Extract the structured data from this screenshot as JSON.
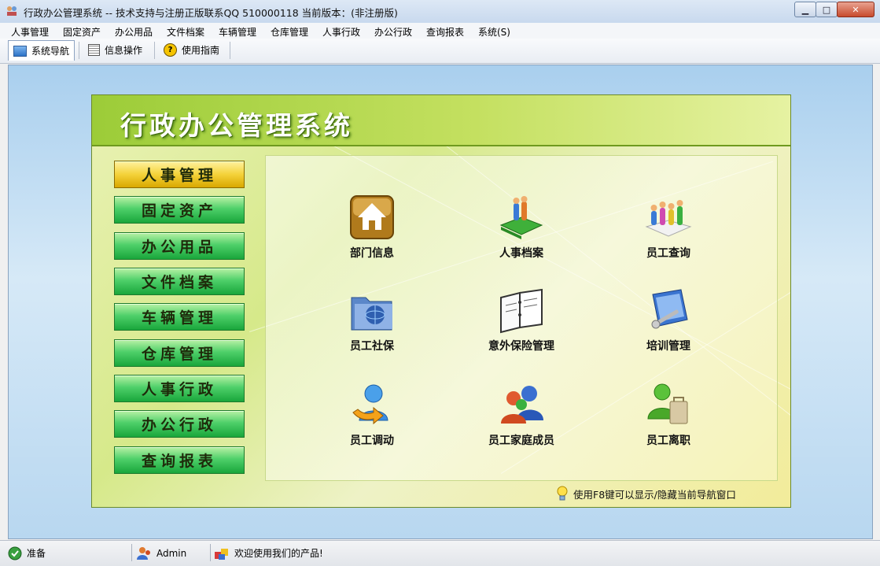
{
  "window": {
    "title": "行政办公管理系统 -- 技术支持与注册正版联系QQ 510000118   当前版本：(非注册版)",
    "min_glyph": "▁",
    "max_glyph": "□",
    "close_glyph": "✕"
  },
  "menu": [
    "人事管理",
    "固定资产",
    "办公用品",
    "文件档案",
    "车辆管理",
    "仓库管理",
    "人事行政",
    "办公行政",
    "查询报表",
    "系统(S)"
  ],
  "toolbar": {
    "nav": "系统导航",
    "info": "信息操作",
    "help": "使用指南",
    "help_glyph": "?"
  },
  "panel": {
    "title": "行政办公管理系统",
    "nav_buttons": [
      "人事管理",
      "固定资产",
      "办公用品",
      "文件档案",
      "车辆管理",
      "仓库管理",
      "人事行政",
      "办公行政",
      "查询报表"
    ],
    "selected_nav": "人事管理",
    "tiles": [
      "部门信息",
      "人事档案",
      "员工查询",
      "员工社保",
      "意外保险管理",
      "培训管理",
      "员工调动",
      "员工家庭成员",
      "员工离职"
    ],
    "hint": "使用F8键可以显示/隐藏当前导航窗口"
  },
  "status": {
    "ready": "准备",
    "user": "Admin",
    "welcome": "欢迎使用我们的产品!"
  },
  "colors": {
    "panel_green": "#9ccc38",
    "nav_green": "#19a63b",
    "nav_selected": "#f4d23a"
  }
}
